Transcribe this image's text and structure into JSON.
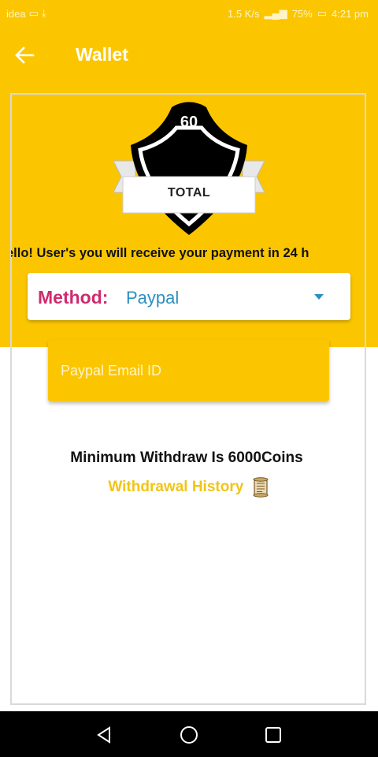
{
  "status_bar": {
    "carrier": "idea",
    "speed": "1.5 K/s",
    "battery": "75%",
    "time": "4:21 pm"
  },
  "app_bar": {
    "title": "Wallet"
  },
  "badge": {
    "coins": "60",
    "label": "TOTAL"
  },
  "notice": "ello! User's you will receive your payment in 24 h",
  "method": {
    "label": "Method:",
    "selected": "Paypal"
  },
  "email_field": {
    "placeholder": "Paypal Email ID",
    "value": ""
  },
  "minimum_text": "Minimum Withdraw Is 6000Coins",
  "history_link": "Withdrawal History",
  "colors": {
    "primary": "#fbc600",
    "method_label": "#d02a6e",
    "method_value": "#2b8fc0",
    "history_link": "#f2c417"
  }
}
